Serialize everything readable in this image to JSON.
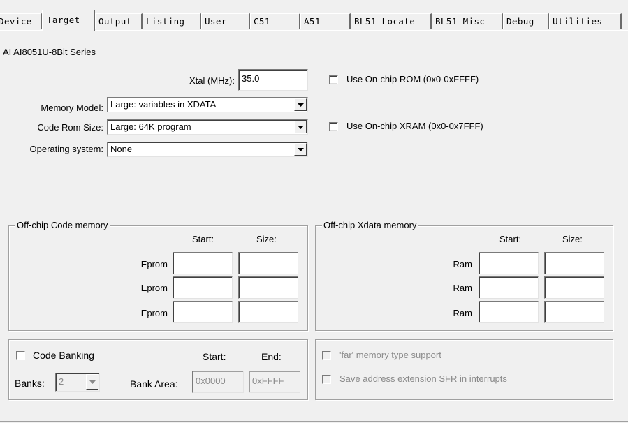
{
  "tabs": [
    {
      "key": "device",
      "label": "Device"
    },
    {
      "key": "target",
      "label": "Target"
    },
    {
      "key": "output",
      "label": "Output"
    },
    {
      "key": "listing",
      "label": "Listing"
    },
    {
      "key": "user",
      "label": "User"
    },
    {
      "key": "c51",
      "label": "C51"
    },
    {
      "key": "a51",
      "label": "A51"
    },
    {
      "key": "bl51_locate",
      "label": "BL51 Locate"
    },
    {
      "key": "bl51_misc",
      "label": "BL51 Misc"
    },
    {
      "key": "debug",
      "label": "Debug"
    },
    {
      "key": "utilities",
      "label": "Utilities"
    }
  ],
  "active_tab": "Target",
  "device_name": "AI AI8051U-8Bit Series",
  "xtal": {
    "label": "Xtal (MHz):",
    "value": "35.0"
  },
  "memory_model": {
    "label": "Memory Model:",
    "value": "Large: variables in XDATA"
  },
  "code_rom_size": {
    "label": "Code Rom Size:",
    "value": "Large: 64K program"
  },
  "operating_system": {
    "label": "Operating system:",
    "value": "None"
  },
  "use_onchip_rom": {
    "label": "Use On-chip ROM (0x0-0xFFFF)",
    "checked": false
  },
  "use_onchip_xram": {
    "label": "Use On-chip XRAM (0x0-0x7FFF)",
    "checked": false
  },
  "offchip_code": {
    "title": "Off-chip Code memory",
    "start_header": "Start:",
    "size_header": "Size:",
    "rows": [
      {
        "label": "Eprom",
        "start": "",
        "size": ""
      },
      {
        "label": "Eprom",
        "start": "",
        "size": ""
      },
      {
        "label": "Eprom",
        "start": "",
        "size": ""
      }
    ]
  },
  "offchip_xdata": {
    "title": "Off-chip Xdata memory",
    "start_header": "Start:",
    "size_header": "Size:",
    "rows": [
      {
        "label": "Ram",
        "start": "",
        "size": ""
      },
      {
        "label": "Ram",
        "start": "",
        "size": ""
      },
      {
        "label": "Ram",
        "start": "",
        "size": ""
      }
    ]
  },
  "banking": {
    "code_banking_label": "Code Banking",
    "code_banking_checked": false,
    "start_header": "Start:",
    "end_header": "End:",
    "banks_label": "Banks:",
    "banks_value": "2",
    "bank_area_label": "Bank Area:",
    "bank_area_start": "0x0000",
    "bank_area_end": "0xFFFF"
  },
  "far_memory": {
    "label": "'far' memory type support",
    "checked": false,
    "enabled": false
  },
  "save_sfr": {
    "label": "Save address extension SFR in interrupts",
    "checked": false,
    "enabled": false
  },
  "colors": {
    "background": "#f0f0f0",
    "field_bg": "#ffffff",
    "disabled_text": "#8a8a8a"
  }
}
